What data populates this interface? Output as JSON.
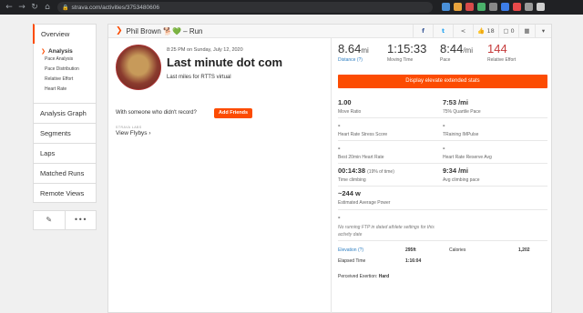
{
  "browser": {
    "url": "strava.com/activities/3753480606",
    "back_icon": "back-arrow-icon",
    "forward_icon": "forward-arrow-icon",
    "reload_icon": "reload-icon",
    "home_icon": "home-icon",
    "lock_icon": "lock-icon",
    "extension_colors": [
      "#4a90d9",
      "#e8a33d",
      "#d94a4a",
      "#4ab06a",
      "#888888",
      "#3d7de8",
      "#e84a4a",
      "#9a9a9a",
      "#cfcfcf"
    ]
  },
  "sidebar": {
    "overview": "Overview",
    "analysis_header": "Analysis",
    "analysis_items": [
      "Pace Analysis",
      "Pace Distribution",
      "Relative Effort",
      "Heart Rate"
    ],
    "items": [
      "Analysis Graph",
      "Segments",
      "Laps",
      "Matched Runs",
      "Remote Views"
    ],
    "tool_icons": [
      "pencil-icon",
      "more-icon"
    ]
  },
  "header": {
    "athlete_activity": "Phil Brown 🐕💚 – Run",
    "actions": {
      "facebook": "f",
      "twitter": "t",
      "share": "<",
      "kudos_count": "18",
      "comments_count": "0"
    },
    "accent": "#fc4c02"
  },
  "activity": {
    "date": "8:25 PM on Sunday, July 12, 2020",
    "name": "Last minute dot com",
    "description": "Last miles for RTTS virtual",
    "with_text": "With someone who didn't record?",
    "add_friends": "Add Friends",
    "flyby_label": "STRAVA LABS",
    "view_flybys": "View Flybys"
  },
  "stats": {
    "distance_value": "8.64",
    "distance_unit": "mi",
    "distance_label": "Distance (?)",
    "moving_time_value": "1:15:33",
    "moving_time_label": "Moving Time",
    "pace_value": "8:44",
    "pace_unit": "/mi",
    "pace_label": "Pace",
    "relative_effort_value": "144",
    "relative_effort_label": "Relative Effort",
    "relative_effort_color": "#c53a3a",
    "elevate_button": "Display elevate extended stats"
  },
  "extended": {
    "move_ratio_value": "1.00",
    "move_ratio_label": "Move Ratio",
    "quartile_pace_value": "7:53 /mi",
    "quartile_pace_label": "75% Quartile Pace",
    "hrss_value": "-",
    "hrss_label": "Heart Rate Stress Score",
    "trimp_value": "-",
    "trimp_label": "TRaining IMPulse",
    "best20_value": "-",
    "best20_label": "Best 20min Heart Rate",
    "hrr_value": "-",
    "hrr_label": "Heart Rate Reserve Avg",
    "climb_time_value": "00:14:38",
    "climb_time_pct": "(19% of time)",
    "climb_time_label": "Time climbing",
    "climb_pace_value": "9:34 /mi",
    "climb_pace_label": "Avg climbing pace",
    "power_value": "~244 w",
    "power_label": "Estimated Average Power",
    "ftp_value": "-",
    "ftp_note": "No running FTP in dated athlete settings for this activity date"
  },
  "bottom": {
    "elevation_label": "Elevation (?)",
    "elevation_value": "295ft",
    "calories_label": "Calories",
    "calories_value": "1,202",
    "elapsed_label": "Elapsed Time",
    "elapsed_value": "1:16:04",
    "perceived_label": "Perceived Exertion:",
    "perceived_value": "Hard"
  }
}
